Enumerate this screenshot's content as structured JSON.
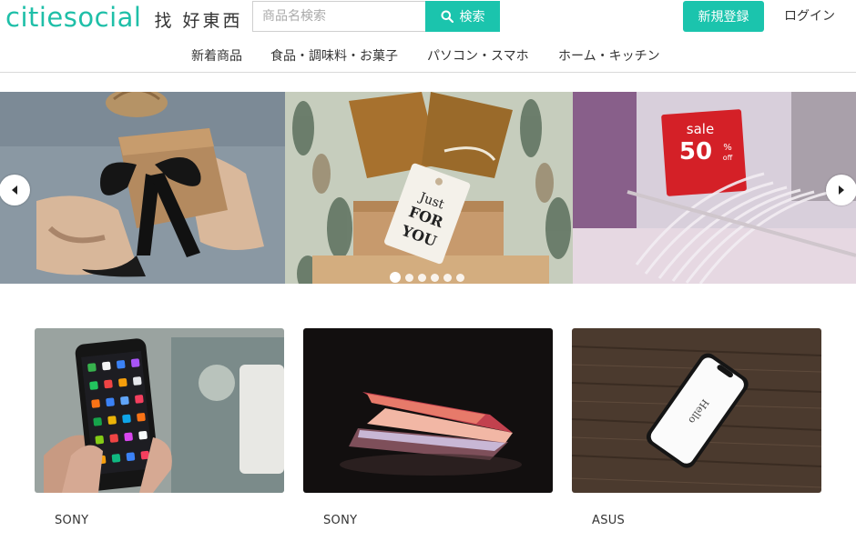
{
  "logo": {
    "brand": "citiesocial",
    "tagline": "找 好東西"
  },
  "search": {
    "placeholder": "商品名検索",
    "button_label": "検索",
    "value": ""
  },
  "header": {
    "signup_label": "新規登録",
    "login_label": "ログイン"
  },
  "nav": {
    "items": [
      "新着商品",
      "食品・調味料・お菓子",
      "パソコン・スマホ",
      "ホーム・キッチン"
    ]
  },
  "carousel": {
    "slides": [
      {
        "alt": "gift wrapping"
      },
      {
        "alt": "Just FOR YOU tag",
        "tag_lines": [
          "Just",
          "FOR",
          "YOU"
        ]
      },
      {
        "alt": "sale",
        "sale_word": "sale",
        "sale_value": "50",
        "sale_unit": "%",
        "sale_off": "off"
      }
    ],
    "dot_count": 6,
    "active_index": 0
  },
  "products": [
    {
      "brand": "SONY"
    },
    {
      "brand": "SONY"
    },
    {
      "brand": "ASUS",
      "screen_text": "Hello"
    }
  ],
  "colors": {
    "accent": "#1bc4ad",
    "sale_red": "#d42027"
  }
}
